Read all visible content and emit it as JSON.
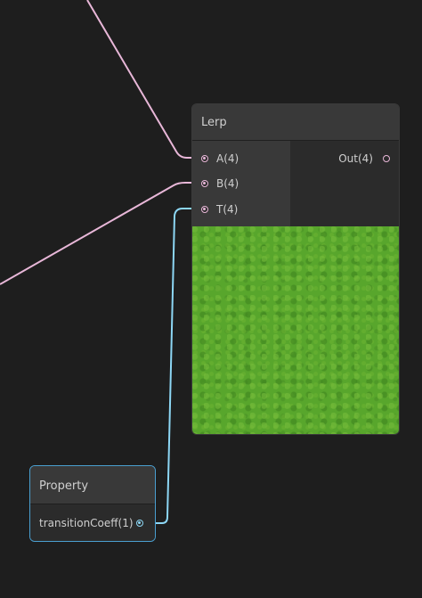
{
  "canvas": {
    "background": "#1e1e1e"
  },
  "lerp_node": {
    "title": "Lerp",
    "inputs": [
      {
        "label": "A(4)",
        "connected": true
      },
      {
        "label": "B(4)",
        "connected": true
      },
      {
        "label": "T(4)",
        "connected": true
      }
    ],
    "outputs": [
      {
        "label": "Out(4)",
        "connected": false
      }
    ],
    "preview_color": "#58a62c"
  },
  "property_node": {
    "title": "Property",
    "outputs": [
      {
        "label": "transitionCoeff(1)",
        "connected": true
      }
    ],
    "border_color": "#4a9fd0"
  },
  "colors": {
    "vector_wire": "#e8b7d8",
    "scalar_wire": "#8dd7f5"
  }
}
